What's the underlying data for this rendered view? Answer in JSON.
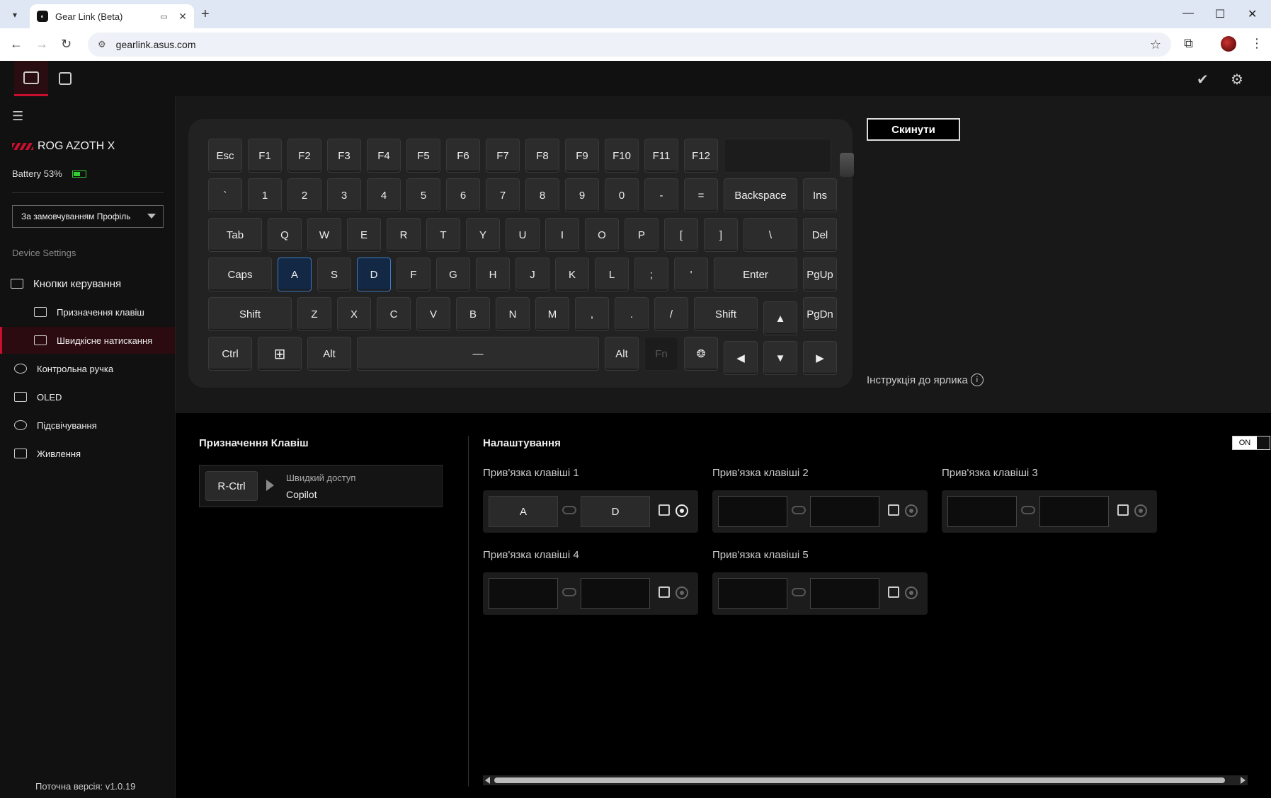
{
  "browser": {
    "tab_title": "Gear Link (Beta)",
    "url": "gearlink.asus.com"
  },
  "sidebar": {
    "device_name": "ROG AZOTH X",
    "battery": "Battery 53%",
    "battery_level": 0.53,
    "profile": "За замовчуванням Профіль",
    "section": "Device Settings",
    "items": [
      {
        "label": "Кнопки керування"
      },
      {
        "label": "Призначення клавіш"
      },
      {
        "label": "Швидкісне натискання"
      },
      {
        "label": "Контрольна ручка"
      },
      {
        "label": "OLED"
      },
      {
        "label": "Підсвічування"
      },
      {
        "label": "Живлення"
      }
    ],
    "version": "Поточна версія: v1.0.19"
  },
  "keyboard": {
    "reset_label": "Скинути",
    "instruction": "Інструкція до ярлика",
    "rows": [
      [
        "Esc",
        "F1",
        "F2",
        "F3",
        "F4",
        "F5",
        "F6",
        "F7",
        "F8",
        "F9",
        "F10",
        "F11",
        "F12"
      ],
      [
        "`",
        "1",
        "2",
        "3",
        "4",
        "5",
        "6",
        "7",
        "8",
        "9",
        "0",
        "-",
        "=",
        "Backspace",
        "Ins"
      ],
      [
        "Tab",
        "Q",
        "W",
        "E",
        "R",
        "T",
        "Y",
        "U",
        "I",
        "O",
        "P",
        "[",
        "]",
        "\\",
        "Del"
      ],
      [
        "Caps",
        "A",
        "S",
        "D",
        "F",
        "G",
        "H",
        "J",
        "K",
        "L",
        ";",
        "'",
        "Enter",
        "PgUp"
      ],
      [
        "Shift",
        "Z",
        "X",
        "C",
        "V",
        "B",
        "N",
        "M",
        ",",
        ".",
        "/",
        "Shift",
        "▲",
        "PgDn"
      ],
      [
        "Ctrl",
        "⊞",
        "Alt",
        "—",
        "Alt",
        "Fn",
        "copilot-icon",
        "◀",
        "▼",
        "▶"
      ]
    ]
  },
  "assign": {
    "title": "Призначення Клавіш",
    "key": "R-Ctrl",
    "sub": "Швидкий доступ",
    "value": "Copilot"
  },
  "settings": {
    "title": "Налаштування",
    "toggle": "ON",
    "bindings": [
      {
        "label": "Прив'язка клавіші 1",
        "a": "A",
        "b": "D"
      },
      {
        "label": "Прив'язка клавіші 2",
        "a": "",
        "b": ""
      },
      {
        "label": "Прив'язка клавіші 3",
        "a": "",
        "b": ""
      },
      {
        "label": "Прив'язка клавіші 4",
        "a": "",
        "b": ""
      },
      {
        "label": "Прив'язка клавіші 5",
        "a": "",
        "b": ""
      }
    ]
  },
  "colors": {
    "accent": "#c8102e",
    "highlight": "#3d7cc9"
  }
}
